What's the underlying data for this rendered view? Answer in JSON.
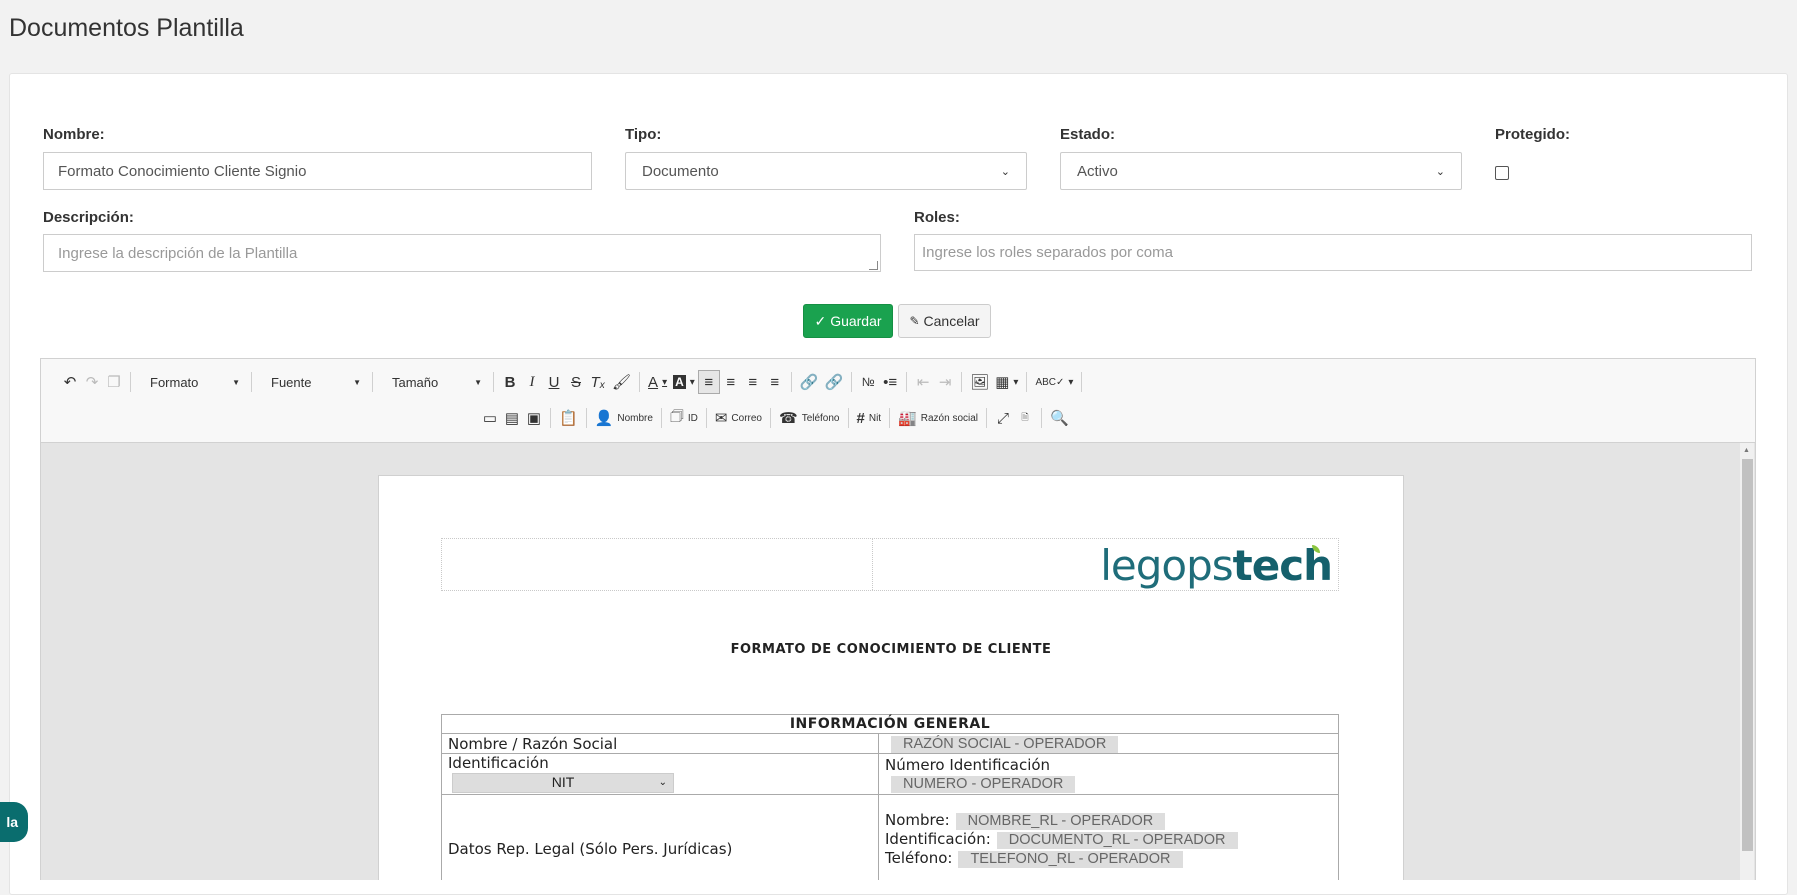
{
  "page": {
    "title": "Documentos Plantilla"
  },
  "form": {
    "nombre": {
      "label": "Nombre:",
      "value": "Formato Conocimiento Cliente Signio"
    },
    "tipo": {
      "label": "Tipo:",
      "value": "Documento"
    },
    "estado": {
      "label": "Estado:",
      "value": "Activo"
    },
    "protegido": {
      "label": "Protegido:",
      "checked": false
    },
    "descripcion": {
      "label": "Descripción:",
      "placeholder": "Ingrese la descripción de la Plantilla"
    },
    "roles": {
      "label": "Roles:",
      "placeholder": "Ingrese los roles separados por coma"
    }
  },
  "actions": {
    "save_label": "Guardar",
    "cancel_label": "Cancelar"
  },
  "toolbar": {
    "format_label": "Formato",
    "font_label": "Fuente",
    "size_label": "Tamaño",
    "placeholders": {
      "nombre": "Nombre",
      "id": "ID",
      "correo": "Correo",
      "telefono": "Teléfono",
      "nit": "Nit",
      "razon_social": "Razón social"
    }
  },
  "document": {
    "logo_light": "legops",
    "logo_bold": "tech",
    "heading": "FORMATO DE CONOCIMIENTO DE CLIENTE",
    "table_title": "INFORMACIÓN GENERAL",
    "rows": {
      "razon_label": "Nombre / Razón Social",
      "razon_value": "RAZÓN SOCIAL - OPERADOR",
      "ident_label": "Identificación",
      "ident_type": "NIT",
      "numero_label": "Número Identificación",
      "numero_value": "NUMERO - OPERADOR",
      "rep_label": "Datos Rep. Legal  (Sólo Pers. Jurídicas)",
      "rep_nombre_label": "Nombre:",
      "rep_nombre_value": "NOMBRE_RL - OPERADOR",
      "rep_ident_label": "Identificación:",
      "rep_ident_value": "DOCUMENTO_RL - OPERADOR",
      "rep_tel_label": "Teléfono:",
      "rep_tel_value": "TELEFONO_RL - OPERADOR"
    }
  },
  "floating_tab": {
    "label": "la"
  },
  "colors": {
    "primary_green": "#1aa24f",
    "brand_teal": "#0a6d6e",
    "logo_text": "#1f6d7a",
    "logo_leaf": "#8cc63f"
  }
}
